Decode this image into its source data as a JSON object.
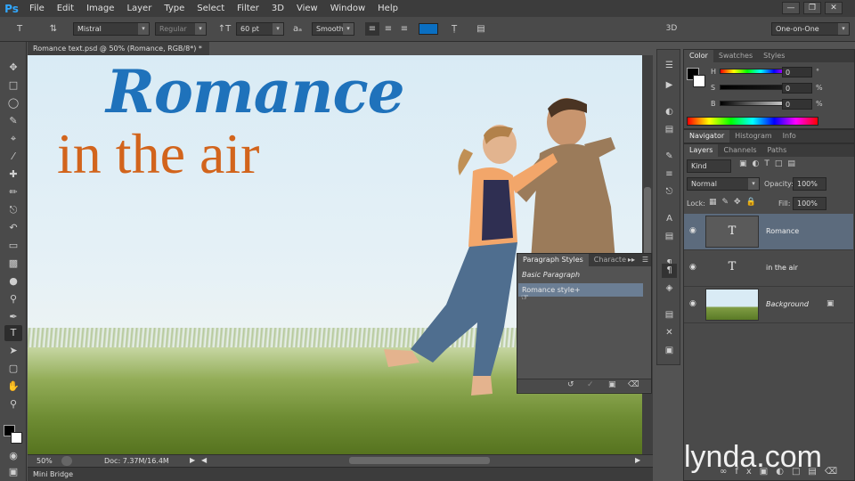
{
  "menu": {
    "logo": "Ps",
    "items": [
      "File",
      "Edit",
      "Image",
      "Layer",
      "Type",
      "Select",
      "Filter",
      "3D",
      "View",
      "Window",
      "Help"
    ]
  },
  "options": {
    "font_family": "Mistral",
    "font_style": "Regular",
    "font_size": "60 pt",
    "aa_label": "aₐ",
    "antialias": "Smooth",
    "text_color": "#0a6fc2",
    "mode_3d": "3D",
    "workspace": "One-on-One"
  },
  "document": {
    "tab_title": "Romance text.psd @ 50% (Romance, RGB/8*) *",
    "close": "×",
    "text_line1": "Romance",
    "text_line2": "in the air",
    "zoom": "50%",
    "doc_size": "Doc: 7.37M/16.4M",
    "mini_bridge": "Mini Bridge"
  },
  "color_panel": {
    "tabs": [
      "Color",
      "Swatches",
      "Styles"
    ],
    "channels": [
      {
        "label": "H",
        "value": "0",
        "unit": "°"
      },
      {
        "label": "S",
        "value": "0",
        "unit": "%"
      },
      {
        "label": "B",
        "value": "0",
        "unit": "%"
      }
    ]
  },
  "navigator_tabs": [
    "Navigator",
    "Histogram",
    "Info"
  ],
  "layers_panel": {
    "tabs": [
      "Layers",
      "Channels",
      "Paths"
    ],
    "filter_kind": "Kind",
    "blend_mode": "Normal",
    "opacity_label": "Opacity:",
    "opacity": "100%",
    "lock_label": "Lock:",
    "fill_label": "Fill:",
    "fill": "100%",
    "layers": [
      {
        "name": "Romance",
        "type": "T",
        "selected": true
      },
      {
        "name": "in the air",
        "type": "T",
        "selected": false
      },
      {
        "name": "Background",
        "type": "image",
        "selected": false,
        "locked": true
      }
    ]
  },
  "paragraph_styles": {
    "tabs": [
      "Paragraph Styles",
      "Characte"
    ],
    "items": [
      {
        "name": "Basic Paragraph",
        "selected": false
      },
      {
        "name": "Romance style+",
        "selected": true
      }
    ]
  },
  "watermark": "lynda.com"
}
